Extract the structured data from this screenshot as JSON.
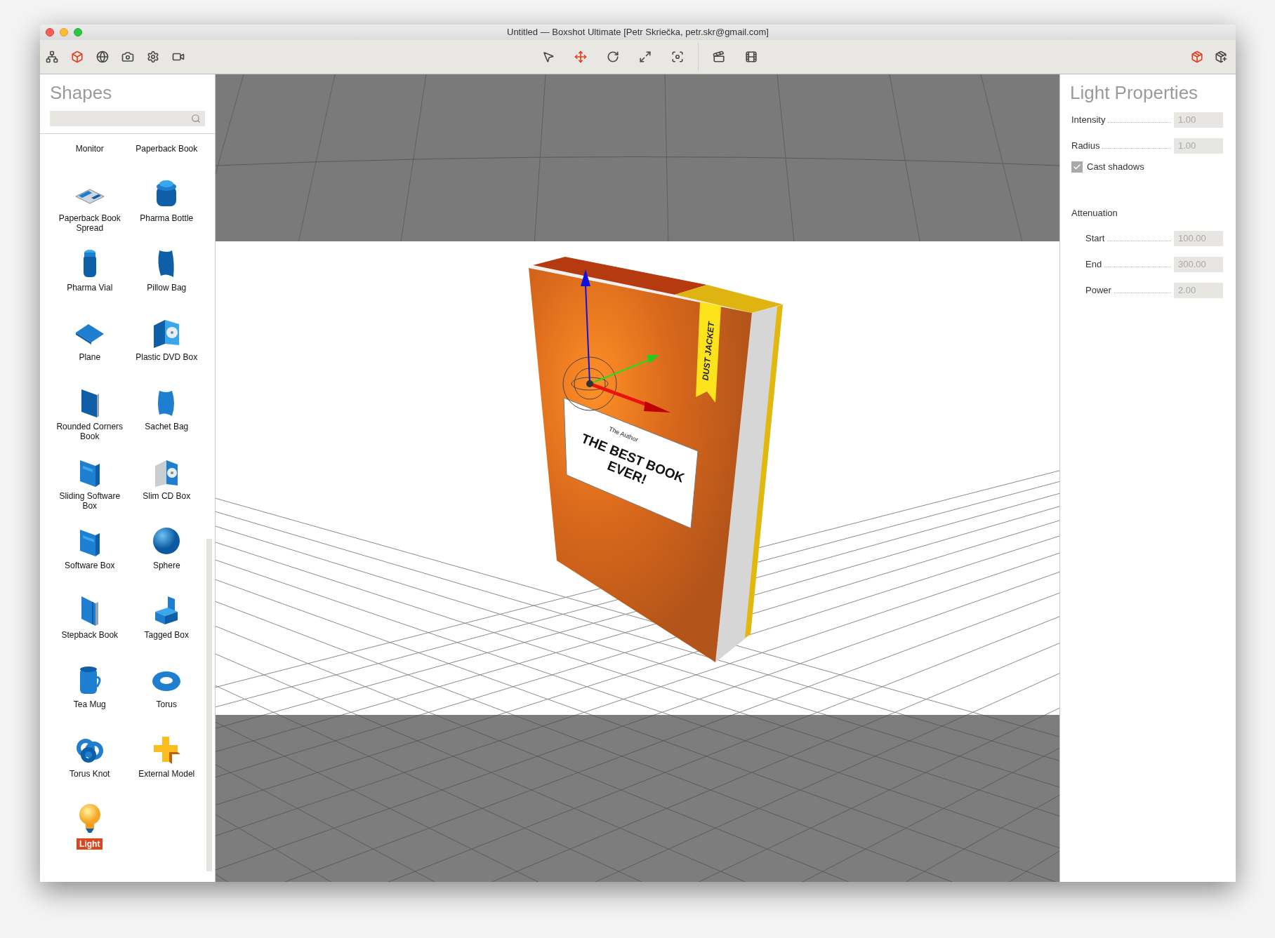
{
  "window": {
    "title": "Untitled — Boxshot Ultimate [Petr Skriečka, petr.skr@gmail.com]"
  },
  "toolbar": {
    "left": [
      {
        "selected": false
      },
      {
        "selected": true
      },
      {
        "selected": false
      },
      {
        "selected": false
      },
      {
        "selected": false
      },
      {
        "selected": false
      }
    ],
    "center": [
      {
        "selected": false
      },
      {
        "selected": true
      },
      {
        "selected": false
      },
      {
        "selected": false
      },
      {
        "selected": false
      }
    ],
    "animation": [
      {
        "selected": false
      },
      {
        "selected": false
      }
    ],
    "right": [
      {
        "selected": true
      },
      {
        "selected": false
      }
    ]
  },
  "shapes_panel": {
    "title": "Shapes",
    "items": [
      {
        "label": "Monitor",
        "selected": false
      },
      {
        "label": "Paperback Book",
        "selected": false
      },
      {
        "label": "Paperback Book Spread",
        "selected": false
      },
      {
        "label": "Pharma Bottle",
        "selected": false
      },
      {
        "label": "Pharma Vial",
        "selected": false
      },
      {
        "label": "Pillow Bag",
        "selected": false
      },
      {
        "label": "Plane",
        "selected": false
      },
      {
        "label": "Plastic DVD Box",
        "selected": false
      },
      {
        "label": "Rounded Corners Book",
        "selected": false
      },
      {
        "label": "Sachet Bag",
        "selected": false
      },
      {
        "label": "Sliding Software Box",
        "selected": false
      },
      {
        "label": "Slim CD Box",
        "selected": false
      },
      {
        "label": "Software Box",
        "selected": false
      },
      {
        "label": "Sphere",
        "selected": false
      },
      {
        "label": "Stepback Book",
        "selected": false
      },
      {
        "label": "Tagged Box",
        "selected": false
      },
      {
        "label": "Tea Mug",
        "selected": false
      },
      {
        "label": "Torus",
        "selected": false
      },
      {
        "label": "Torus Knot",
        "selected": false
      },
      {
        "label": "External Model",
        "selected": false
      },
      {
        "label": "Light",
        "selected": true
      }
    ]
  },
  "viewport": {
    "book": {
      "ribbon": "DUST JACKET",
      "author": "The Author",
      "title_lines": [
        "THE BEST BOOK",
        "EVER!"
      ]
    }
  },
  "properties": {
    "title": "Light Properties",
    "fields": [
      {
        "label": "Intensity",
        "value": "1.00",
        "disabled": true
      },
      {
        "label": "Radius",
        "value": "1.00",
        "disabled": true
      }
    ],
    "cast_shadows": {
      "label": "Cast shadows",
      "checked": true
    },
    "section": "Attenuation",
    "attenuation_fields": [
      {
        "label": "Start",
        "value": "100.00",
        "disabled": true
      },
      {
        "label": "End",
        "value": "300.00",
        "disabled": true
      },
      {
        "label": "Power",
        "value": "2.00",
        "disabled": true
      }
    ]
  }
}
